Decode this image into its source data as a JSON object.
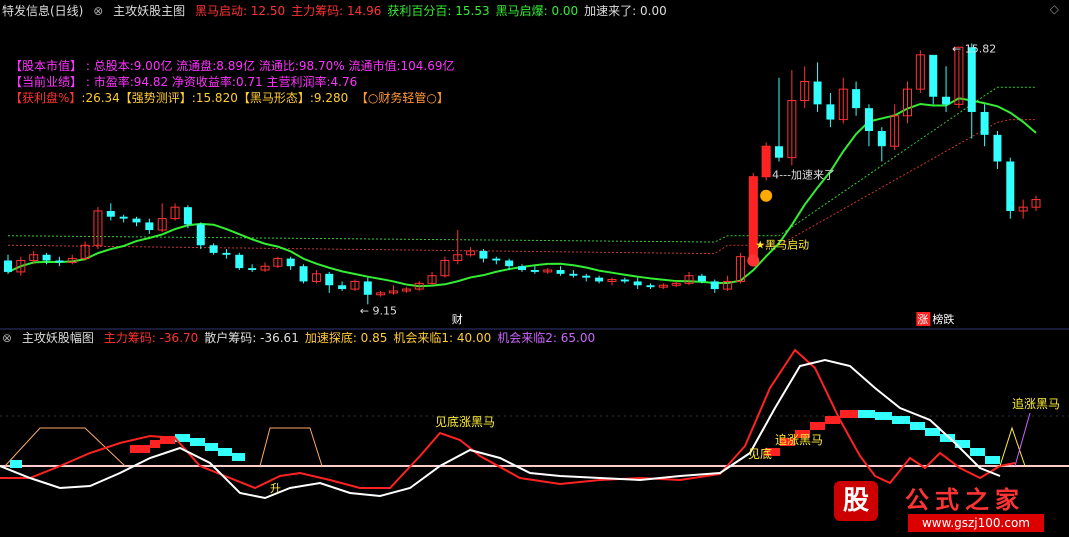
{
  "main_header": {
    "window_title": "特发信息(日线)",
    "indicator": "主攻妖股主图",
    "items": [
      {
        "label": "黑马启动: 12.50",
        "color": "#ff3333"
      },
      {
        "label": "主力筹码: 14.96",
        "color": "#ff3333"
      },
      {
        "label": "获利百分百: 15.53",
        "color": "#33ee33"
      },
      {
        "label": "黑马启爆: 0.00",
        "color": "#33ee33"
      },
      {
        "label": "加速来了: 0.00",
        "color": "#dddddd"
      }
    ]
  },
  "info_lines": [
    {
      "label": "【股本市值】",
      "text": " :  总股本:9.00亿 流通盘:8.89亿 流通比:98.70% 流通市值:104.69亿",
      "label_color": "#ff33ff",
      "color": "#ff33ff"
    },
    {
      "label": "【当前业绩】",
      "text": " :  市盈率:94.82 净资收益率:0.71 主营利润率:4.76",
      "label_color": "#ff33ff",
      "color": "#ff33ff"
    },
    {
      "label": "【获利盘%】",
      "text": ":26.34【强势测评】:15.820【黑马形态】:9.280",
      "label_color": "#ff3333",
      "color": "#ffcc33",
      "tail": "【○财务轻管○】",
      "tail_color": "#ff9933"
    }
  ],
  "annotations": {
    "high": "15.82",
    "low": "9.15",
    "accel": "4---加速来了",
    "start": "★黑马启动",
    "cai": "财",
    "zhang": "涨",
    "plunge": "榜跌"
  },
  "sub_header": {
    "indicator": "主攻妖股幅图",
    "items": [
      {
        "label": "主力筹码: -36.70",
        "color": "#ff3333"
      },
      {
        "label": "散户筹码: -36.61",
        "color": "#dddddd"
      },
      {
        "label": "加速探底: 0.85",
        "color": "#ffcc33"
      },
      {
        "label": "机会来临1: 40.00",
        "color": "#ffcc33"
      },
      {
        "label": "机会来临2: 65.00",
        "color": "#cc66ff"
      }
    ]
  },
  "sub_labels": {
    "l1": "见底涨黑马",
    "l2": "追涨黑马",
    "l3": "见底",
    "l4": "追涨黑马",
    "l5": "升"
  },
  "watermark": {
    "text": "公式之家",
    "url": "www.gszj100.com",
    "logo": "股"
  },
  "chart_data": {
    "type": "candlestick",
    "price_range": [
      9.0,
      16.3
    ],
    "candles": [
      [
        10.3,
        10.0,
        10.45,
        9.95
      ],
      [
        10.0,
        10.3,
        10.4,
        9.9
      ],
      [
        10.3,
        10.45,
        10.55,
        10.2
      ],
      [
        10.45,
        10.3,
        10.5,
        10.2
      ],
      [
        10.3,
        10.25,
        10.4,
        10.15
      ],
      [
        10.25,
        10.35,
        10.45,
        10.2
      ],
      [
        10.35,
        10.7,
        10.8,
        10.3
      ],
      [
        10.7,
        11.6,
        11.7,
        10.6
      ],
      [
        11.6,
        11.45,
        11.8,
        11.35
      ],
      [
        11.45,
        11.4,
        11.5,
        11.3
      ],
      [
        11.4,
        11.3,
        11.45,
        11.2
      ],
      [
        11.3,
        11.1,
        11.4,
        11.0
      ],
      [
        11.1,
        11.4,
        11.8,
        11.05
      ],
      [
        11.4,
        11.7,
        11.8,
        11.35
      ],
      [
        11.7,
        11.25,
        11.75,
        11.15
      ],
      [
        11.25,
        10.7,
        11.3,
        10.6
      ],
      [
        10.7,
        10.5,
        10.75,
        10.45
      ],
      [
        10.5,
        10.45,
        10.6,
        10.35
      ],
      [
        10.45,
        10.1,
        10.5,
        10.05
      ],
      [
        10.1,
        10.05,
        10.2,
        10.0
      ],
      [
        10.05,
        10.15,
        10.25,
        10.0
      ],
      [
        10.15,
        10.35,
        10.4,
        10.1
      ],
      [
        10.35,
        10.15,
        10.4,
        10.05
      ],
      [
        10.15,
        9.75,
        10.2,
        9.7
      ],
      [
        9.75,
        9.95,
        10.05,
        9.7
      ],
      [
        9.95,
        9.65,
        10.0,
        9.45
      ],
      [
        9.65,
        9.55,
        9.75,
        9.5
      ],
      [
        9.55,
        9.75,
        9.8,
        9.5
      ],
      [
        9.75,
        9.4,
        9.85,
        9.15
      ],
      [
        9.4,
        9.45,
        9.5,
        9.35
      ],
      [
        9.45,
        9.5,
        9.65,
        9.4
      ],
      [
        9.5,
        9.55,
        9.6,
        9.45
      ],
      [
        9.55,
        9.7,
        9.75,
        9.5
      ],
      [
        9.7,
        9.9,
        10.0,
        9.65
      ],
      [
        9.9,
        10.3,
        10.4,
        9.85
      ],
      [
        10.3,
        10.45,
        11.1,
        10.2
      ],
      [
        10.45,
        10.55,
        10.65,
        10.4
      ],
      [
        10.55,
        10.35,
        10.6,
        10.25
      ],
      [
        10.35,
        10.3,
        10.4,
        10.2
      ],
      [
        10.3,
        10.15,
        10.35,
        10.05
      ],
      [
        10.15,
        10.05,
        10.2,
        10.0
      ],
      [
        10.05,
        10.0,
        10.15,
        9.95
      ],
      [
        10.0,
        10.05,
        10.1,
        9.95
      ],
      [
        10.05,
        9.95,
        10.15,
        9.9
      ],
      [
        9.95,
        9.9,
        10.05,
        9.85
      ],
      [
        9.9,
        9.85,
        9.95,
        9.75
      ],
      [
        9.85,
        9.75,
        9.9,
        9.7
      ],
      [
        9.75,
        9.8,
        9.85,
        9.65
      ],
      [
        9.8,
        9.75,
        9.85,
        9.7
      ],
      [
        9.75,
        9.65,
        9.85,
        9.55
      ],
      [
        9.65,
        9.6,
        9.7,
        9.55
      ],
      [
        9.6,
        9.65,
        9.7,
        9.55
      ],
      [
        9.65,
        9.7,
        9.75,
        9.6
      ],
      [
        9.7,
        9.9,
        10.0,
        9.65
      ],
      [
        9.9,
        9.75,
        9.95,
        9.7
      ],
      [
        9.75,
        9.55,
        9.8,
        9.45
      ],
      [
        9.55,
        9.75,
        9.9,
        9.5
      ],
      [
        9.75,
        10.4,
        10.5,
        9.7
      ],
      [
        10.4,
        12.5,
        12.6,
        10.3
      ],
      [
        12.5,
        13.3,
        13.4,
        12.4
      ],
      [
        13.3,
        13.0,
        15.1,
        12.9
      ],
      [
        13.0,
        14.5,
        15.3,
        12.8
      ],
      [
        14.5,
        15.0,
        15.4,
        14.3
      ],
      [
        15.0,
        14.4,
        15.5,
        14.2
      ],
      [
        14.4,
        14.0,
        14.7,
        13.8
      ],
      [
        14.0,
        14.8,
        15.1,
        13.9
      ],
      [
        14.8,
        14.3,
        15.0,
        14.1
      ],
      [
        14.3,
        13.7,
        14.4,
        13.3
      ],
      [
        13.7,
        13.3,
        13.8,
        12.9
      ],
      [
        13.3,
        14.1,
        14.4,
        13.2
      ],
      [
        14.1,
        14.8,
        15.0,
        13.9
      ],
      [
        14.8,
        15.7,
        15.82,
        14.7
      ],
      [
        15.7,
        14.6,
        15.6,
        14.4
      ],
      [
        14.6,
        14.4,
        15.4,
        14.2
      ],
      [
        14.4,
        15.9,
        15.82,
        14.3
      ],
      [
        15.9,
        14.2,
        16.0,
        13.5
      ],
      [
        14.2,
        13.6,
        14.4,
        13.3
      ],
      [
        13.6,
        12.9,
        13.7,
        12.7
      ],
      [
        12.9,
        11.6,
        13.0,
        11.4
      ],
      [
        11.6,
        11.7,
        11.9,
        11.4
      ],
      [
        11.7,
        11.9,
        12.0,
        11.6
      ]
    ]
  }
}
